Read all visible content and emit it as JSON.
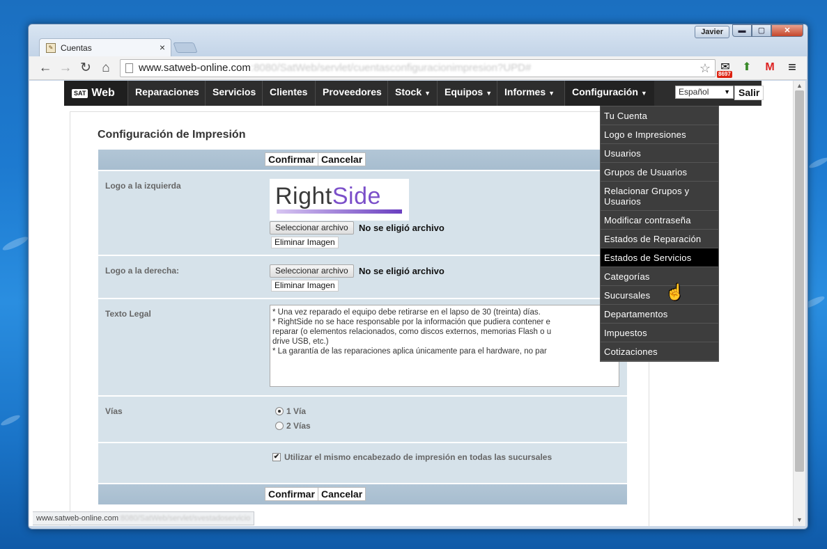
{
  "browser": {
    "tab_title": "Cuentas",
    "tab_close": "×",
    "profile_name": "Javier",
    "window_buttons": {
      "minimize": "▬",
      "maximize": "▢",
      "close": "✕"
    },
    "url_host": "www.satweb-online.com",
    "url_path": ":8080/SatWeb/servlet/cuentasconfiguracionimpresion?UPD#",
    "star": "☆",
    "extensions": [
      {
        "name": "mail-checker",
        "badge": "8697"
      },
      {
        "name": "bookmark"
      },
      {
        "name": "gmail",
        "label": "M"
      },
      {
        "name": "menu",
        "label": "≡"
      }
    ],
    "nav": {
      "back": "←",
      "forward": "→",
      "reload": "↻",
      "home": "⌂"
    },
    "status_host": "www.satweb-online.com",
    "status_path": ":8080/SatWeb/servlet/svestadoservicio",
    "colors": {
      "frame": "#c9d7e8",
      "accent": "#2d2d2d"
    }
  },
  "site": {
    "brand_badge": "SAT",
    "brand_name": "Web",
    "nav_items": [
      {
        "label": "Reparaciones",
        "caret": ""
      },
      {
        "label": "Servicios",
        "caret": ""
      },
      {
        "label": "Clientes",
        "caret": ""
      },
      {
        "label": "Proveedores",
        "caret": ""
      },
      {
        "label": "Stock",
        "caret": "▼"
      },
      {
        "label": "Equipos",
        "caret": "▼"
      },
      {
        "label": "Informes",
        "caret": "▼"
      },
      {
        "label": "Configuración",
        "caret": "▼"
      }
    ],
    "language": "Español",
    "logout": "Salir",
    "config_menu": [
      "Tu Cuenta",
      "Logo e Impresiones",
      "Usuarios",
      "Grupos de Usuarios",
      "Relacionar Grupos y Usuarios",
      "Modificar contraseña",
      "Estados de Reparación",
      "Estados de Servicios",
      "Categorías",
      "Sucursales",
      "Departamentos",
      "Impuestos",
      "Cotizaciones"
    ],
    "hovered_menu_item": "Estados de Servicios"
  },
  "form": {
    "title": "Configuración de Impresión",
    "confirm": "Confirmar",
    "cancel": "Cancelar",
    "logo_left_label": "Logo a la izquierda",
    "logo_brand": {
      "part1": "Right",
      "part2": "Side"
    },
    "select_file": "Seleccionar archivo",
    "no_file": "No se eligió archivo",
    "delete_image": "Eliminar Imagen",
    "logo_right_label": "Logo a la derecha:",
    "legal_label": "Texto Legal",
    "legal_text": "* Una vez reparado el equipo debe retirarse en el lapso de 30 (treinta) días.\n* RightSide no se hace responsable por la información que pudiera contener e\nreparar (o elementos relacionados, como discos externos, memorias Flash o u\ndrive USB, etc.)\n* La garantía de las reparaciones aplica únicamente para el hardware, no par",
    "copies_label": "Vías",
    "copies_options": [
      {
        "label": "1 Vía",
        "selected": true
      },
      {
        "label": "2 Vías",
        "selected": false
      }
    ],
    "same_header_label": "Utilizar el mismo encabezado de impresión en todas las sucursales",
    "same_header_checked": "✔"
  }
}
